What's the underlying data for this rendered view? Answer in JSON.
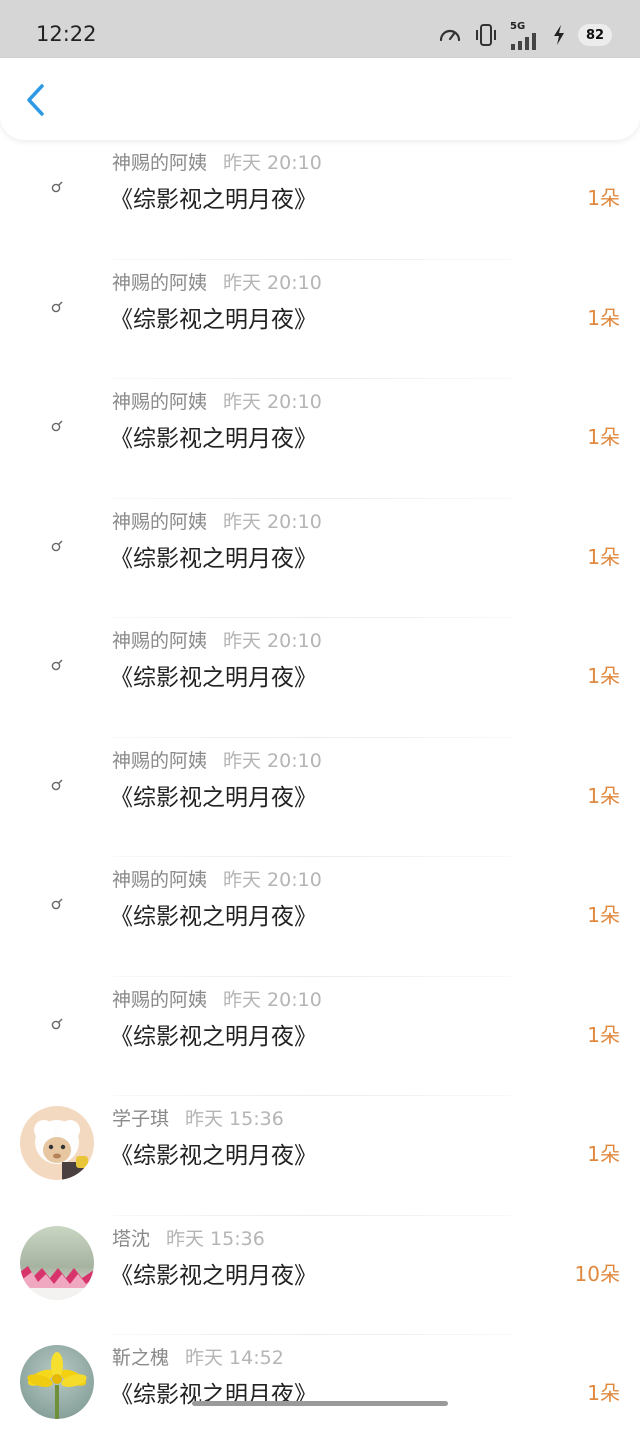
{
  "status_bar": {
    "time": "12:22",
    "network": "5G",
    "battery": "82"
  },
  "header": {
    "back_icon": "chevron-left-icon",
    "accent_color": "#2e9ae6"
  },
  "count_color": "#e0893e",
  "items": [
    {
      "name": "神赐的阿姨",
      "time": "昨天 20:10",
      "title": "《综影视之明月夜》",
      "count": "1朵",
      "avatar": "broken-image-icon"
    },
    {
      "name": "神赐的阿姨",
      "time": "昨天 20:10",
      "title": "《综影视之明月夜》",
      "count": "1朵",
      "avatar": "broken-image-icon"
    },
    {
      "name": "神赐的阿姨",
      "time": "昨天 20:10",
      "title": "《综影视之明月夜》",
      "count": "1朵",
      "avatar": "broken-image-icon"
    },
    {
      "name": "神赐的阿姨",
      "time": "昨天 20:10",
      "title": "《综影视之明月夜》",
      "count": "1朵",
      "avatar": "broken-image-icon"
    },
    {
      "name": "神赐的阿姨",
      "time": "昨天 20:10",
      "title": "《综影视之明月夜》",
      "count": "1朵",
      "avatar": "broken-image-icon"
    },
    {
      "name": "神赐的阿姨",
      "time": "昨天 20:10",
      "title": "《综影视之明月夜》",
      "count": "1朵",
      "avatar": "broken-image-icon"
    },
    {
      "name": "神赐的阿姨",
      "time": "昨天 20:10",
      "title": "《综影视之明月夜》",
      "count": "1朵",
      "avatar": "broken-image-icon"
    },
    {
      "name": "神赐的阿姨",
      "time": "昨天 20:10",
      "title": "《综影视之明月夜》",
      "count": "1朵",
      "avatar": "broken-image-icon"
    },
    {
      "name": "学子琪",
      "time": "昨天 15:36",
      "title": "《综影视之明月夜》",
      "count": "1朵",
      "avatar": "sheep-cartoon-avatar"
    },
    {
      "name": "塔沈",
      "time": "昨天 15:36",
      "title": "《综影视之明月夜》",
      "count": "10朵",
      "avatar": "paper-cranes-avatar"
    },
    {
      "name": "靳之槐",
      "time": "昨天 14:52",
      "title": "《综影视之明月夜》",
      "count": "1朵",
      "avatar": "yellow-flower-avatar"
    }
  ]
}
